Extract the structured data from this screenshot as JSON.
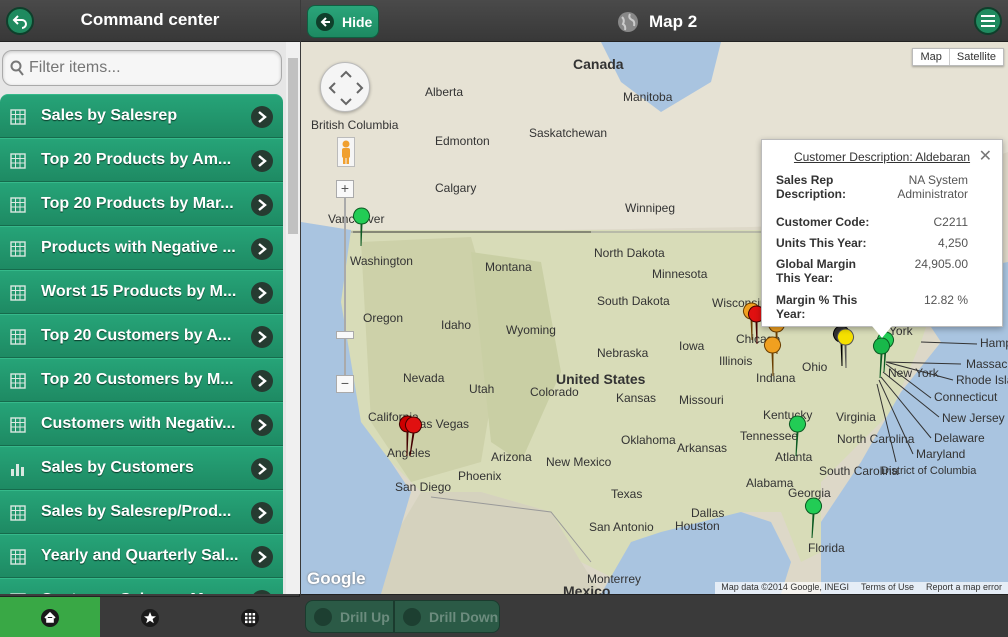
{
  "sidebar": {
    "title": "Command center",
    "filter_placeholder": "Filter items...",
    "items": [
      {
        "label": "Sales by Salesrep",
        "icon": "grid-icon"
      },
      {
        "label": "Top 20 Products by Am...",
        "icon": "grid-icon"
      },
      {
        "label": "Top 20 Products by Mar...",
        "icon": "grid-icon"
      },
      {
        "label": "Products with Negative ...",
        "icon": "grid-icon"
      },
      {
        "label": "Worst 15 Products by M...",
        "icon": "grid-icon"
      },
      {
        "label": "Top 20 Customers by A...",
        "icon": "grid-icon"
      },
      {
        "label": "Top 20 Customers by M...",
        "icon": "grid-icon"
      },
      {
        "label": "Customers with Negativ...",
        "icon": "grid-icon"
      },
      {
        "label": "Sales by Customers",
        "icon": "bar-chart-icon"
      },
      {
        "label": "Sales by Salesrep/Prod...",
        "icon": "grid-icon"
      },
      {
        "label": "Yearly and Quarterly Sal...",
        "icon": "grid-icon"
      },
      {
        "label": "Customer Sales on Map",
        "icon": "grid-icon"
      }
    ],
    "footer_tabs": [
      "home",
      "favorites",
      "apps"
    ]
  },
  "main": {
    "hide_label": "Hide",
    "title": "Map 2",
    "map_type": [
      "Map",
      "Satellite"
    ],
    "google": "Google",
    "attribution": [
      "Map data ©2014 Google, INEGI",
      "Terms of Use",
      "Report a map error"
    ],
    "drill_up": "Drill Up",
    "drill_down": "Drill Down"
  },
  "popup": {
    "title": "Customer Description: Aldebaran",
    "rows": [
      {
        "key": "Sales Rep Description:",
        "value": "NA System Administrator"
      },
      {
        "key": "Customer Code:",
        "value": "C2211"
      },
      {
        "key": "Units This Year:",
        "value": "4,250"
      },
      {
        "key": "Global Margin This Year:",
        "value": "24,905.00"
      },
      {
        "key": "Margin % This Year:",
        "value": "12.82 %"
      }
    ]
  },
  "map_labels": {
    "countries": [
      "Canada",
      "United States",
      "Mexico"
    ],
    "places": [
      "Alberta",
      "Manitoba",
      "British Columbia",
      "Edmonton",
      "Saskatchewan",
      "Calgary",
      "Winnipeg",
      "Vancouver",
      "Washington",
      "Montana",
      "North Dakota",
      "Minnesota",
      "Wisconsin",
      "Oregon",
      "Idaho",
      "Wyoming",
      "South Dakota",
      "Nebraska",
      "Iowa",
      "Illinois",
      "Chicago",
      "Indiana",
      "Ohio",
      "York",
      "New York",
      "Nevada",
      "Utah",
      "Colorado",
      "Kansas",
      "Missouri",
      "California",
      "Las Vegas",
      "Kentucky",
      "Virginia",
      "Oklahoma",
      "Tennessee",
      "North Carolina",
      "Angeles",
      "Arizona",
      "New Mexico",
      "Arkansas",
      "Atlanta",
      "South Carolina",
      "Phoenix",
      "San Diego",
      "Alabama",
      "Georgia",
      "Texas",
      "Dallas",
      "San Antonio",
      "Houston",
      "Florida",
      "Monterrey",
      "Mexico",
      "Massac",
      "Rhode Isla",
      "Connecticut",
      "New Jersey",
      "Delaware",
      "Maryland",
      "District of Columbia",
      "Hamp"
    ]
  },
  "colors": {
    "accent": "#1f8a5f",
    "pin_green": "#22cc55",
    "pin_orange": "#f0a020",
    "pin_red": "#e01010",
    "pin_yellow": "#f5e000"
  }
}
